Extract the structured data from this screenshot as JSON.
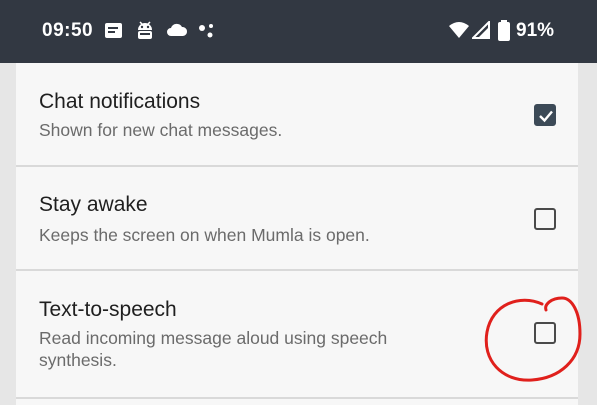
{
  "status_bar": {
    "time": "09:50",
    "left_icons": [
      "notes-icon",
      "android-debug-icon",
      "cloud-icon",
      "assistant-icon"
    ],
    "right_icons": [
      "wifi-icon",
      "signal-icon",
      "battery-icon"
    ],
    "battery": "91%"
  },
  "preferences": [
    {
      "title": "Chat notifications",
      "summary": "Shown for new chat messages.",
      "checked": true
    },
    {
      "title": "Stay awake",
      "summary": "Keeps the screen on when Mumla is open.",
      "checked": false
    },
    {
      "title": "Text-to-speech",
      "summary": "Read incoming message aloud using speech synthesis.",
      "checked": false
    }
  ],
  "annotation": {
    "color": "#e0201c"
  }
}
